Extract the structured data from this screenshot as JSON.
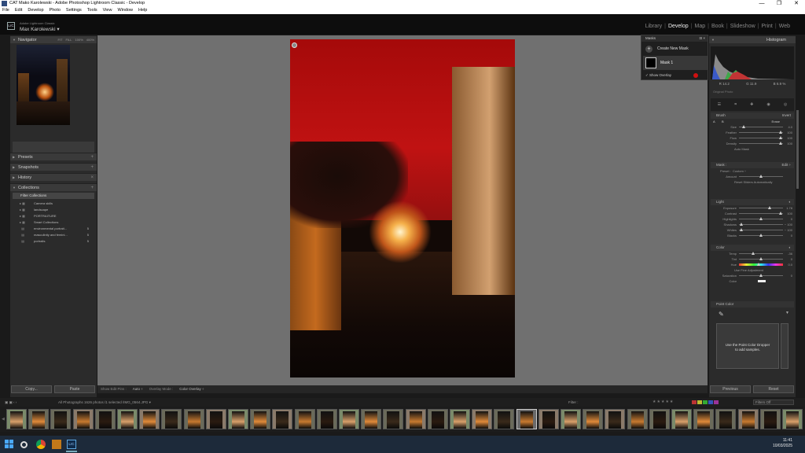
{
  "window": {
    "title": "CAT Mako Karolewski - Adobe Photoshop Lightroom Classic - Develop",
    "controls": [
      "—",
      "❐",
      "✕"
    ]
  },
  "menu": [
    "File",
    "Edit",
    "Develop",
    "Photo",
    "Settings",
    "Tools",
    "View",
    "Window",
    "Help"
  ],
  "identity": {
    "badge": "LrC",
    "product": "Adobe Lightroom Classic",
    "user": "Max Karolewski ▾"
  },
  "modules": [
    "Library",
    "Develop",
    "Map",
    "Book",
    "Slideshow",
    "Print",
    "Web"
  ],
  "left": {
    "navigator": {
      "title": "Navigator",
      "zoom": [
        "FIT",
        "FILL",
        "100%",
        "400%"
      ]
    },
    "presets": "Presets",
    "snapshots": "Snapshots",
    "history": "History",
    "collections": "Collections",
    "filter_collections": "Filter Collections",
    "collection_items": [
      {
        "name": "Camera skills",
        "count": ""
      },
      {
        "name": "landscape",
        "count": ""
      },
      {
        "name": "PORTRAITURE",
        "count": ""
      },
      {
        "name": "Smart Collections",
        "count": ""
      },
      {
        "name": "environmental portrait...",
        "count": "5"
      },
      {
        "name": "masculinity and femini...",
        "count": "5"
      },
      {
        "name": "portraits",
        "count": "5"
      }
    ],
    "copy": "Copy...",
    "paste": "Paste"
  },
  "toolbar": {
    "show_edit_pins_label": "Show Edit Pins :",
    "show_edit_pins": "Auto ÷",
    "overlay_mode_label": "Overlay Mode :",
    "overlay_mode": "Color Overlay ÷"
  },
  "masks": {
    "title": "Masks",
    "create": "Create New Mask",
    "mask_name": "Mask 1",
    "show_overlay": "Show Overlay"
  },
  "right": {
    "histogram": "Histogram",
    "hist_info": [
      "R 14.2",
      "G 11.9",
      "B 6.9 %"
    ],
    "original_photo": "Original Photo",
    "brush": {
      "title": "Brush",
      "invert": "Invert",
      "mode_a": "A",
      "mode_b": "B",
      "mode_erase": "Erase",
      "rows": [
        {
          "label": "Size",
          "value": "4.0",
          "pos": 0.1
        },
        {
          "label": "Feather",
          "value": "100",
          "pos": 0.95
        },
        {
          "label": "Flow",
          "value": "100",
          "pos": 0.95
        },
        {
          "label": "Density",
          "value": "100",
          "pos": 0.95
        }
      ],
      "automask": "Auto Mask"
    },
    "mask_section": {
      "left": "Mask :",
      "right": "Edit ÷"
    },
    "preset": {
      "label": "Preset :",
      "value": "Custom ÷"
    },
    "amount": {
      "label": "Amount",
      "pos": 0.5
    },
    "reset_sliders": "Reset Sliders Automatically",
    "light": {
      "title": "Light",
      "rows": [
        {
          "label": "Exposure",
          "value": "1.78",
          "pos": 0.7
        },
        {
          "label": "Contrast",
          "value": "100",
          "pos": 0.95
        },
        {
          "label": "Highlights",
          "value": "0",
          "pos": 0.5
        },
        {
          "label": "Shadows",
          "value": "− 100",
          "pos": 0.05
        },
        {
          "label": "Whites",
          "value": "− 100",
          "pos": 0.05
        },
        {
          "label": "Blacks",
          "value": "0",
          "pos": 0.5
        }
      ]
    },
    "color": {
      "title": "Color",
      "rows": [
        {
          "label": "Temp",
          "value": "-36",
          "pos": 0.32
        },
        {
          "label": "Tint",
          "value": "0",
          "pos": 0.5
        },
        {
          "label": "Hue",
          "value": "0.0",
          "pos": 0.45
        },
        {
          "label": "Saturation",
          "value": "0",
          "pos": 0.5
        },
        {
          "label": "Color",
          "value": "",
          "pos": 0
        }
      ],
      "fine": "Use Fine Adjustment"
    },
    "point_color": {
      "title": "Point Color",
      "hint1": "Use the Point Color Dropper",
      "hint2": "to add samples."
    },
    "previous": "Previous",
    "reset": "Reset"
  },
  "filmbar": {
    "source": "All Photographs   1626 photos /1 selected /IMG_0564.JPG ▾",
    "filter": "Filter :",
    "filters_off": "Filters Off"
  },
  "taskbar": {
    "time": "11:41",
    "date": "10/03/2025"
  },
  "colors": {
    "mask_overlay": "#c01212",
    "accent": "#d01010"
  }
}
